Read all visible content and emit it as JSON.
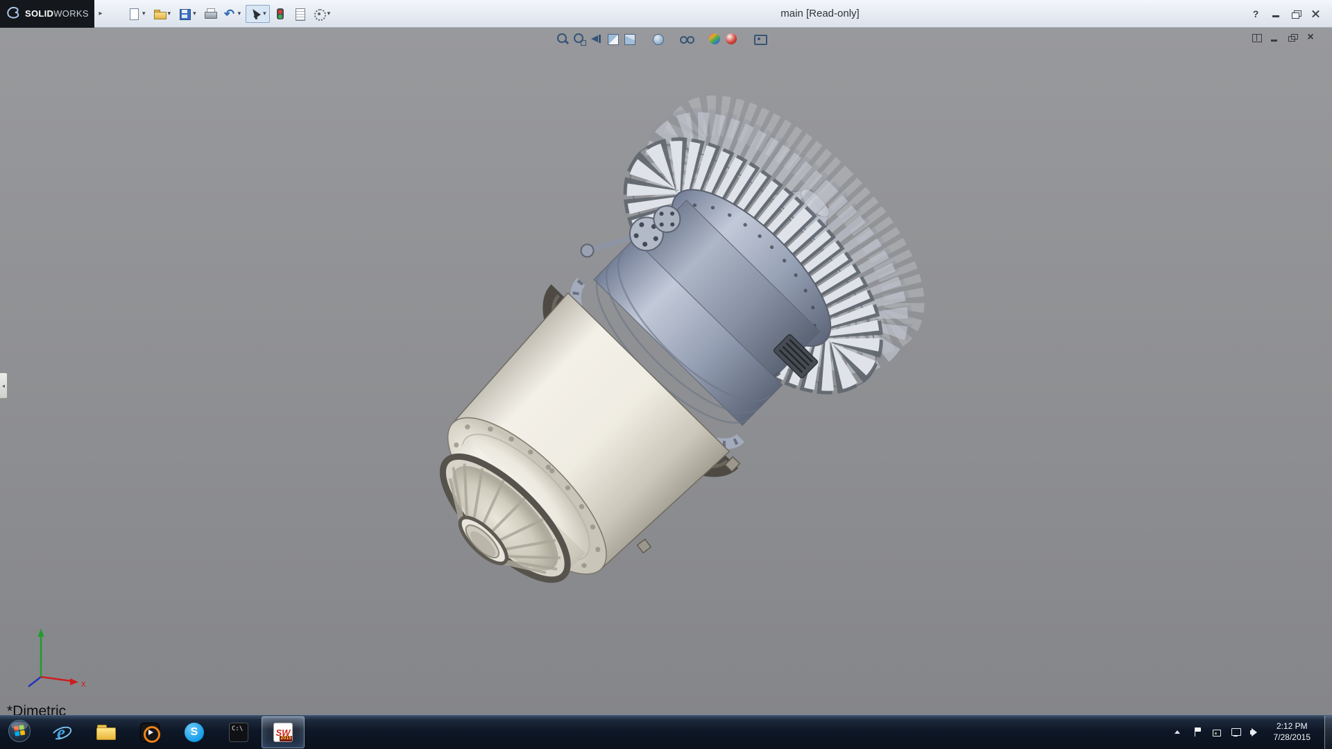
{
  "colors": {
    "tb1": "#f3f6fa",
    "tb2": "#dbe2eb",
    "brand": "#14171c",
    "vp1": "#98999c",
    "vp2": "#85868a",
    "accent_red": "#d12b1f"
  },
  "titlebar": {
    "brand_bold": "SOLID",
    "brand_light": "WORKS",
    "menu_expand_glyph": "▸",
    "caret_glyph": "▾",
    "title": "main [Read-only]",
    "tools": [
      {
        "name": "new-document",
        "dropdown": true
      },
      {
        "name": "open",
        "dropdown": true
      },
      {
        "name": "save",
        "dropdown": true
      },
      {
        "name": "print",
        "dropdown": false
      },
      {
        "name": "undo",
        "glyph": "↶",
        "dropdown": true
      },
      {
        "name": "select",
        "dropdown": true,
        "active": true
      },
      {
        "name": "rebuild",
        "dropdown": false
      },
      {
        "name": "file-properties",
        "dropdown": false
      },
      {
        "name": "options",
        "dropdown": true
      }
    ],
    "window_controls": [
      {
        "name": "help",
        "glyph": "?"
      },
      {
        "name": "minimize"
      },
      {
        "name": "restore"
      },
      {
        "name": "close"
      }
    ]
  },
  "viewport": {
    "headsup_icons": [
      "zoom-to-fit",
      "zoom-to-area",
      "previous-view",
      "section-view",
      "view-orientation",
      "display-style",
      "hide-show-items",
      "edit-appearance",
      "apply-scene",
      "view-settings"
    ],
    "doc_controls": [
      {
        "name": "tile-window"
      },
      {
        "name": "minimize-doc"
      },
      {
        "name": "restore-doc"
      },
      {
        "name": "close-doc",
        "glyph": "×"
      }
    ],
    "panel_toggle_glyph": "◂",
    "orientation_label": "*Dimetric",
    "triad_x_label": "x"
  },
  "taskbar": {
    "apps": [
      {
        "name": "internet-explorer",
        "glyph": "e"
      },
      {
        "name": "windows-explorer"
      },
      {
        "name": "media-player"
      },
      {
        "name": "skype",
        "glyph": "S"
      },
      {
        "name": "command-prompt",
        "glyph": "C:\\"
      },
      {
        "name": "solidworks",
        "glyph": "SW",
        "badge": "2015",
        "active": true
      }
    ],
    "tray_icons": [
      "hidden-icons",
      "action-center",
      "usb",
      "network",
      "volume"
    ],
    "clock_time": "2:12 PM",
    "clock_date": "7/28/2015"
  }
}
